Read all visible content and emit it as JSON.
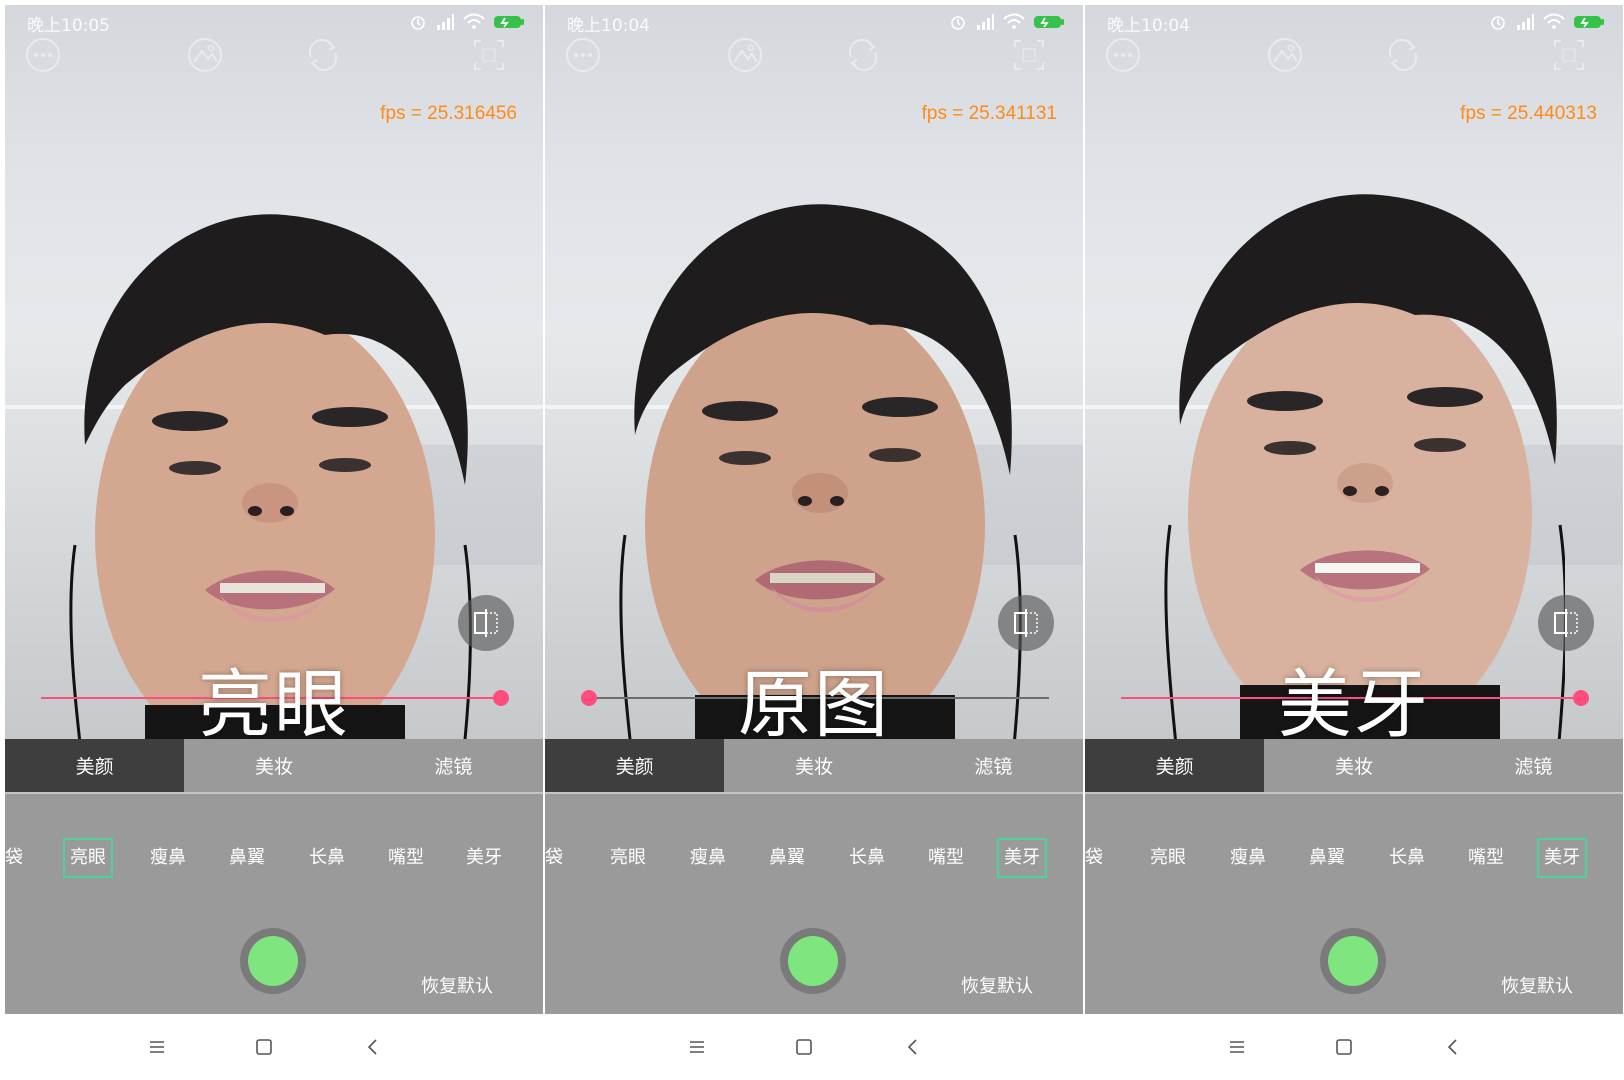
{
  "panels": [
    {
      "status": {
        "time": "晚上10:05"
      },
      "fps": "fps = 25.316456",
      "overlay_label": "亮眼",
      "slider_value": 1.0,
      "tabs": [
        "美颜",
        "美妆",
        "滤镜"
      ],
      "active_tab": 0,
      "items": [
        "眼袋",
        "亮眼",
        "瘦鼻",
        "鼻翼",
        "长鼻",
        "嘴型",
        "美牙"
      ],
      "selected_item": 1,
      "reset_label": "恢复默认"
    },
    {
      "status": {
        "time": "晚上10:04"
      },
      "fps": "fps = 25.341131",
      "overlay_label": "原图",
      "slider_value": 0.0,
      "tabs": [
        "美颜",
        "美妆",
        "滤镜"
      ],
      "active_tab": 0,
      "items": [
        "眼袋",
        "亮眼",
        "瘦鼻",
        "鼻翼",
        "长鼻",
        "嘴型",
        "美牙"
      ],
      "selected_item": 6,
      "reset_label": "恢复默认"
    },
    {
      "status": {
        "time": "晚上10:04"
      },
      "fps": "fps = 25.440313",
      "overlay_label": "美牙",
      "slider_value": 1.0,
      "tabs": [
        "美颜",
        "美妆",
        "滤镜"
      ],
      "active_tab": 0,
      "items": [
        "眼袋",
        "亮眼",
        "瘦鼻",
        "鼻翼",
        "长鼻",
        "嘴型",
        "美牙"
      ],
      "selected_item": 6,
      "reset_label": "恢复默认"
    }
  ],
  "colors": {
    "fps_text": "#ff8a1a",
    "slider": "#ff4d7e",
    "selection_border": "#4fd19a",
    "shutter": "#7fe57f",
    "active_tab_bg": "#3e3e3e",
    "panel_bg": "#9a9a9a"
  },
  "icons": {
    "top": [
      "more-icon",
      "gallery-icon",
      "switch-camera-icon",
      "aspect-ratio-icon"
    ],
    "status": [
      "alarm-icon",
      "signal-icon",
      "wifi-icon",
      "battery-icon"
    ],
    "compare": "compare-icon",
    "nav": [
      "menu-icon",
      "home-icon",
      "back-icon"
    ]
  }
}
